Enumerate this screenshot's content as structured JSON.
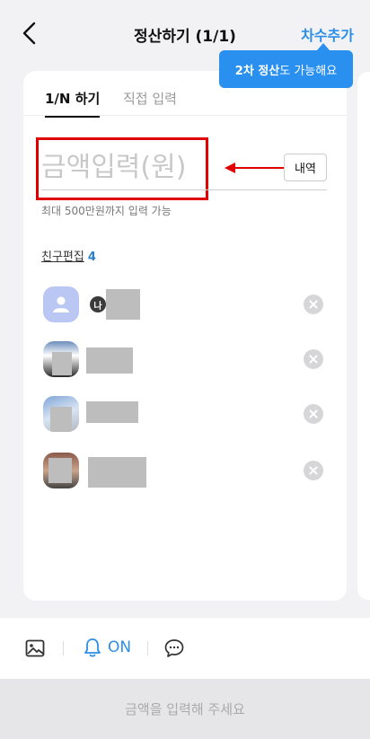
{
  "header": {
    "title": "정산하기 (1/1)",
    "add_round_label": "차수추가"
  },
  "tooltip": {
    "bold": "2차 정산",
    "rest": "도 가능해요"
  },
  "tabs": [
    {
      "label": "1/N 하기",
      "active": true
    },
    {
      "label": "직접 입력",
      "active": false
    }
  ],
  "amount": {
    "placeholder": "금액입력(원)",
    "value": "",
    "hint": "최대 500만원까지 입력 가능"
  },
  "memo_button": "내역",
  "friends": {
    "edit_label": "친구편집",
    "count": "4",
    "list": [
      {
        "avatar": "default-person-icon",
        "me_badge": "나"
      },
      {
        "avatar": "photo"
      },
      {
        "avatar": "photo"
      },
      {
        "avatar": "photo"
      }
    ]
  },
  "bottom": {
    "alarm_label": "ON"
  },
  "submit_label": "금액을 입력해 주세요",
  "colors": {
    "accent": "#2d8ee8",
    "tooltip_bg": "#2a90f0",
    "annotation_red": "#e00000"
  }
}
